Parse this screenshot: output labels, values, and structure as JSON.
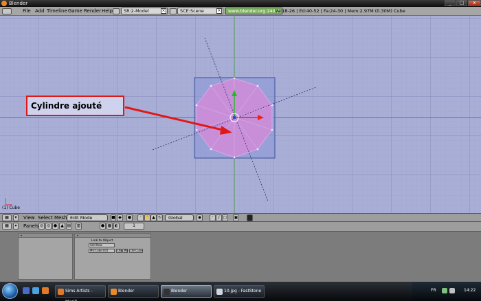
{
  "window": {
    "title": "Blender",
    "min_label": "_",
    "max_label": "□",
    "close_label": "x"
  },
  "infobar": {
    "menus": [
      "File",
      "Add",
      "Timeline",
      "Game",
      "Render",
      "Help"
    ],
    "screen_field": "SR:2-Model",
    "scene_field": "SCE:Scene",
    "url": "www.blender.org 249.2",
    "stats": "Ve:18-26 | Ed:40-52 | Fa:24-30 | Mem:2.97M (0.30M) Cube"
  },
  "viewport": {
    "annotation": "Cylindre ajouté",
    "object_label": "(1) Cube",
    "colors": {
      "background": "#a9aed6",
      "mesh_fill": "#c88fd8",
      "selection_box": "#6e86c8",
      "arrow": "#e01818"
    }
  },
  "header3d": {
    "menus": [
      "View",
      "Select",
      "Mesh"
    ],
    "mode": "Edit Mode",
    "orientation": "Global"
  },
  "panelsbar": {
    "label": "Panels",
    "counter": "1"
  },
  "buttons_panel": {
    "link_label": "Link to Object",
    "add_new": "Add New",
    "mesh_field": "ME:Cube.001",
    "ob_field": "OB:Cube",
    "button_1": "OB",
    "button_2": "ME",
    "button_3": "MA",
    "button_4": "F"
  },
  "taskbar": {
    "items": [
      {
        "label": "Sims Artists - Mozill...",
        "active": false
      },
      {
        "label": "Blender",
        "active": false
      },
      {
        "label": "Blender",
        "active": true
      },
      {
        "label": "10.jpg - FastStone",
        "active": false
      }
    ],
    "language": "FR",
    "clock": "14:22"
  }
}
